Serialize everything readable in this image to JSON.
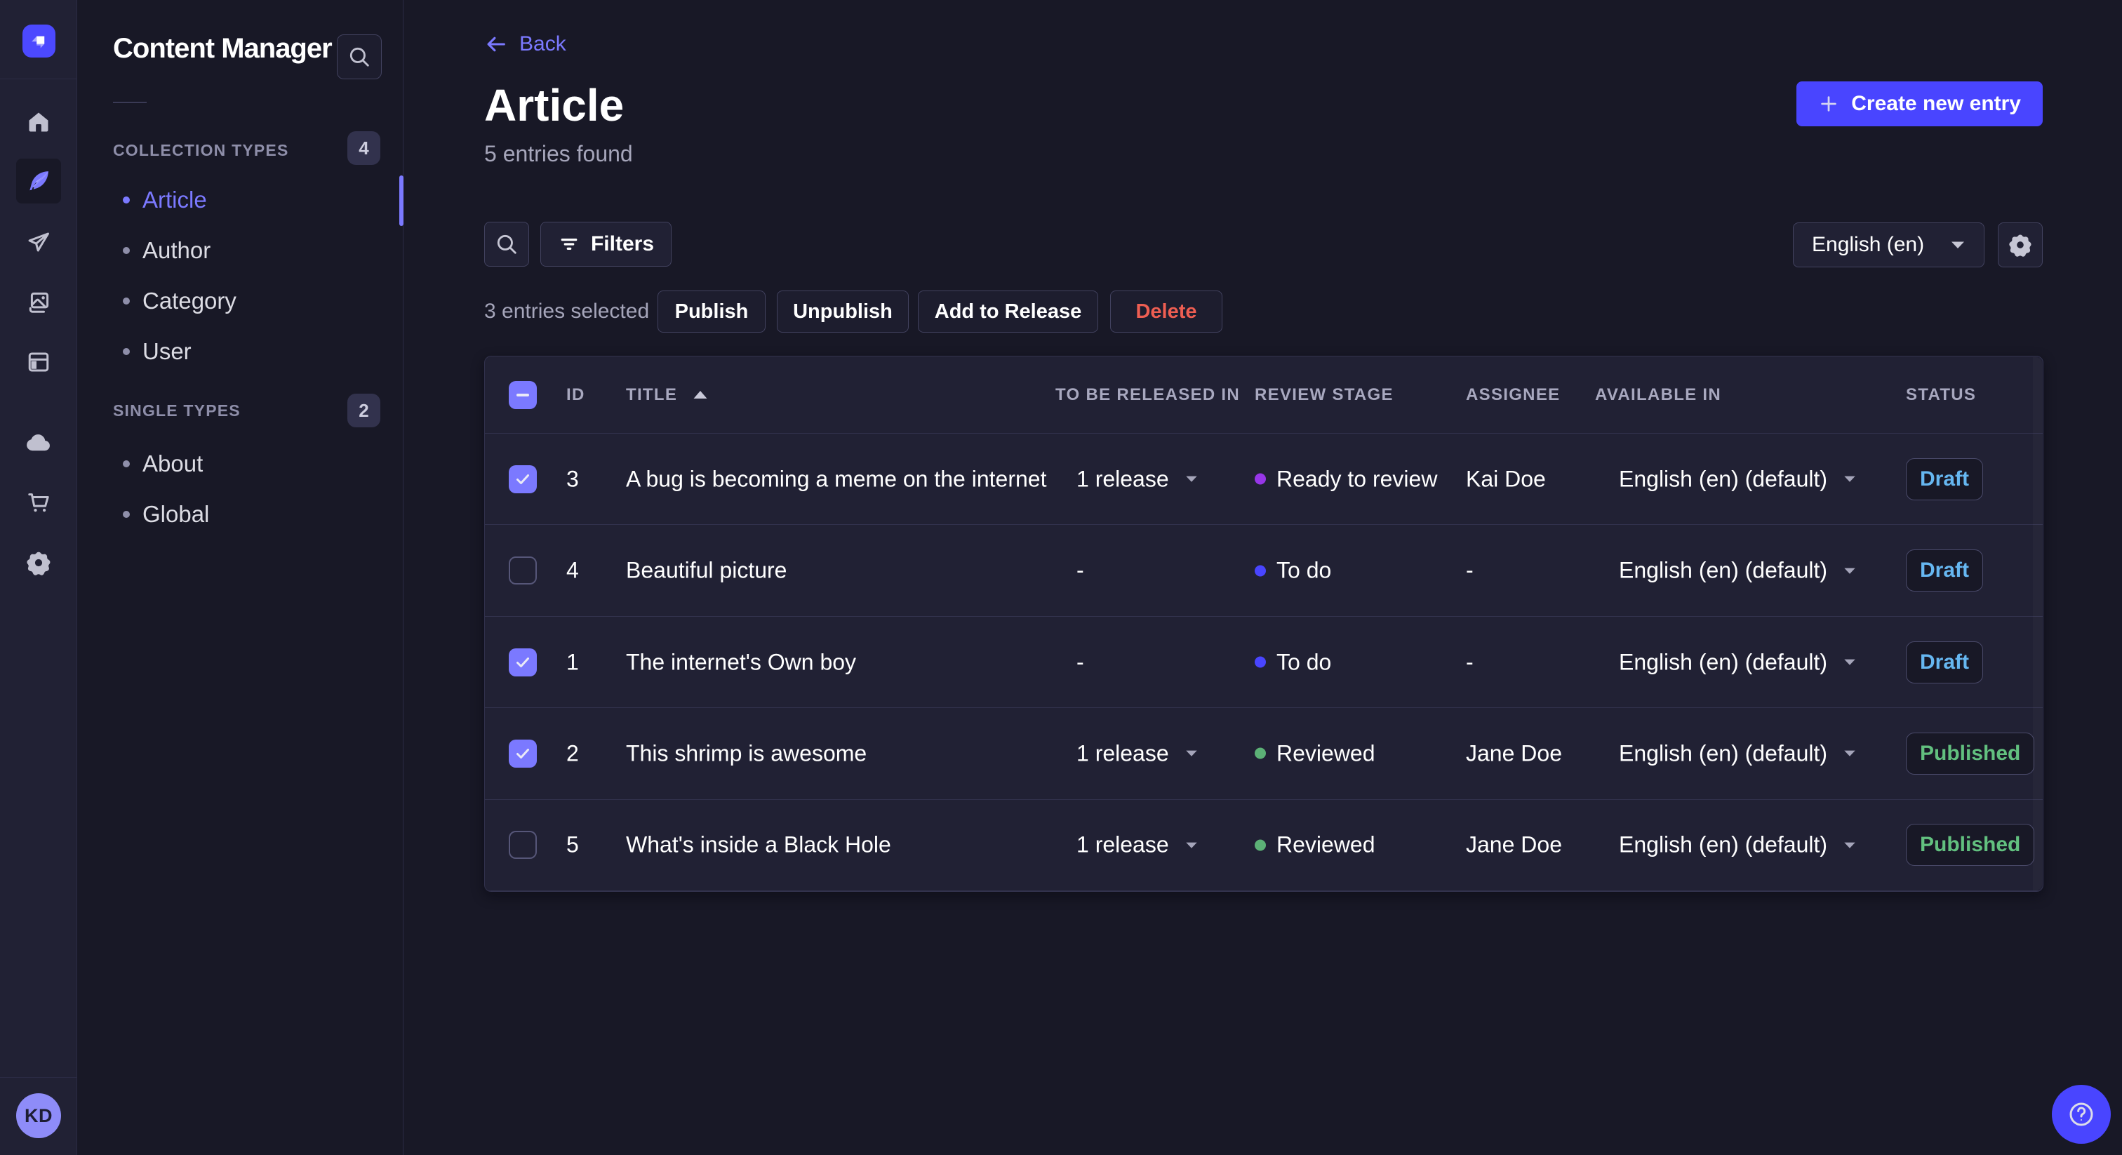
{
  "colors": {
    "primary": "#4945ff",
    "primary_light": "#7b79ff",
    "background": "#181826",
    "surface": "#212134",
    "danger": "#ee5e52",
    "draft_text": "#66b7f1",
    "published_text": "#62c07f",
    "stage_ready_dot": "#9736e8",
    "stage_todo_dot": "#4945ff",
    "stage_reviewed_dot": "#5cb176"
  },
  "rail": {
    "logo_icon": "strapi-logo",
    "items": [
      {
        "icon": "home-icon"
      },
      {
        "icon": "feather-icon",
        "active": true
      },
      {
        "icon": "paper-plane-icon"
      },
      {
        "icon": "images-icon"
      },
      {
        "icon": "layout-icon"
      },
      {
        "icon": "cloud-icon"
      },
      {
        "icon": "cart-icon"
      },
      {
        "icon": "gear-icon"
      }
    ],
    "avatar_initials": "KD"
  },
  "subnav": {
    "title": "Content Manager",
    "search_icon": "search-icon",
    "sections": [
      {
        "label": "COLLECTION TYPES",
        "count": "4",
        "items": [
          {
            "label": "Article",
            "active": true
          },
          {
            "label": "Author"
          },
          {
            "label": "Category"
          },
          {
            "label": "User"
          }
        ]
      },
      {
        "label": "SINGLE TYPES",
        "count": "2",
        "items": [
          {
            "label": "About"
          },
          {
            "label": "Global"
          }
        ]
      }
    ]
  },
  "main": {
    "back_label": "Back",
    "title": "Article",
    "subtitle": "5 entries found",
    "create_button_label": "Create new entry",
    "toolbar": {
      "filters_label": "Filters",
      "locale_value": "English (en)"
    },
    "selection": {
      "text": "3 entries selected",
      "publish_label": "Publish",
      "unpublish_label": "Unpublish",
      "add_to_release_label": "Add to Release",
      "delete_label": "Delete"
    },
    "table": {
      "columns": {
        "id": "ID",
        "title": "TITLE",
        "released_in": "TO BE RELEASED IN",
        "review_stage": "REVIEW STAGE",
        "assignee": "ASSIGNEE",
        "available_in": "AVAILABLE IN",
        "status": "STATUS"
      },
      "sorted_by": "TITLE",
      "sort_direction": "ascending",
      "header_checkbox_state": "indeterminate",
      "rows": [
        {
          "selected": true,
          "id": "3",
          "title": "A bug is becoming a meme on the internet",
          "released_in": "1 release",
          "review_stage": "Ready to review",
          "assignee": "Kai Doe",
          "available_in": "English (en) (default)",
          "status": "Draft"
        },
        {
          "selected": false,
          "id": "4",
          "title": "Beautiful picture",
          "released_in": "-",
          "review_stage": "To do",
          "assignee": "-",
          "available_in": "English (en) (default)",
          "status": "Draft"
        },
        {
          "selected": true,
          "id": "1",
          "title": "The internet's Own boy",
          "released_in": "-",
          "review_stage": "To do",
          "assignee": "-",
          "available_in": "English (en) (default)",
          "status": "Draft"
        },
        {
          "selected": true,
          "id": "2",
          "title": "This shrimp is awesome",
          "released_in": "1 release",
          "review_stage": "Reviewed",
          "assignee": "Jane Doe",
          "available_in": "English (en) (default)",
          "status": "Published"
        },
        {
          "selected": false,
          "id": "5",
          "title": "What's inside a Black Hole",
          "released_in": "1 release",
          "review_stage": "Reviewed",
          "assignee": "Jane Doe",
          "available_in": "English (en) (default)",
          "status": "Published"
        }
      ]
    }
  },
  "help": {
    "icon": "question-mark-icon"
  }
}
